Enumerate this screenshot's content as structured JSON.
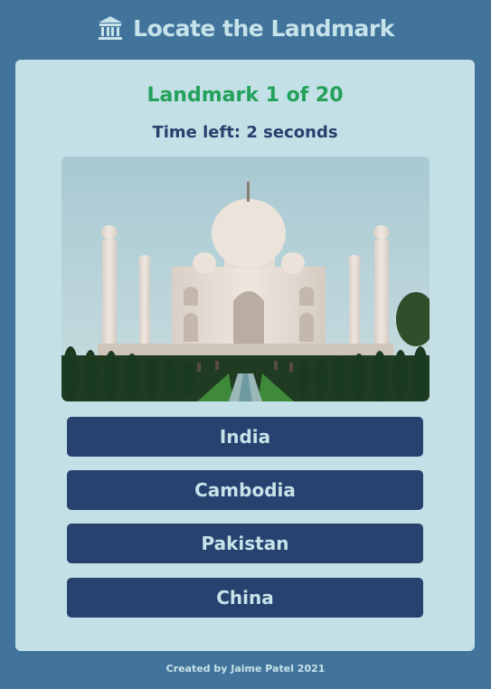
{
  "header": {
    "icon": "bank-building-icon",
    "title": "Locate the Landmark"
  },
  "quiz": {
    "progress": "Landmark 1 of 20",
    "timer": "Time left: 2 seconds",
    "answers": [
      "India",
      "Cambodia",
      "Pakistan",
      "China"
    ]
  },
  "footer": {
    "credit": "Created by Jaime Patel 2021"
  },
  "colors": {
    "background": "#41739b",
    "card": "#c3e0e6",
    "progress_text": "#23a15a",
    "button": "#27426f",
    "light_text": "#c6e3ea"
  }
}
